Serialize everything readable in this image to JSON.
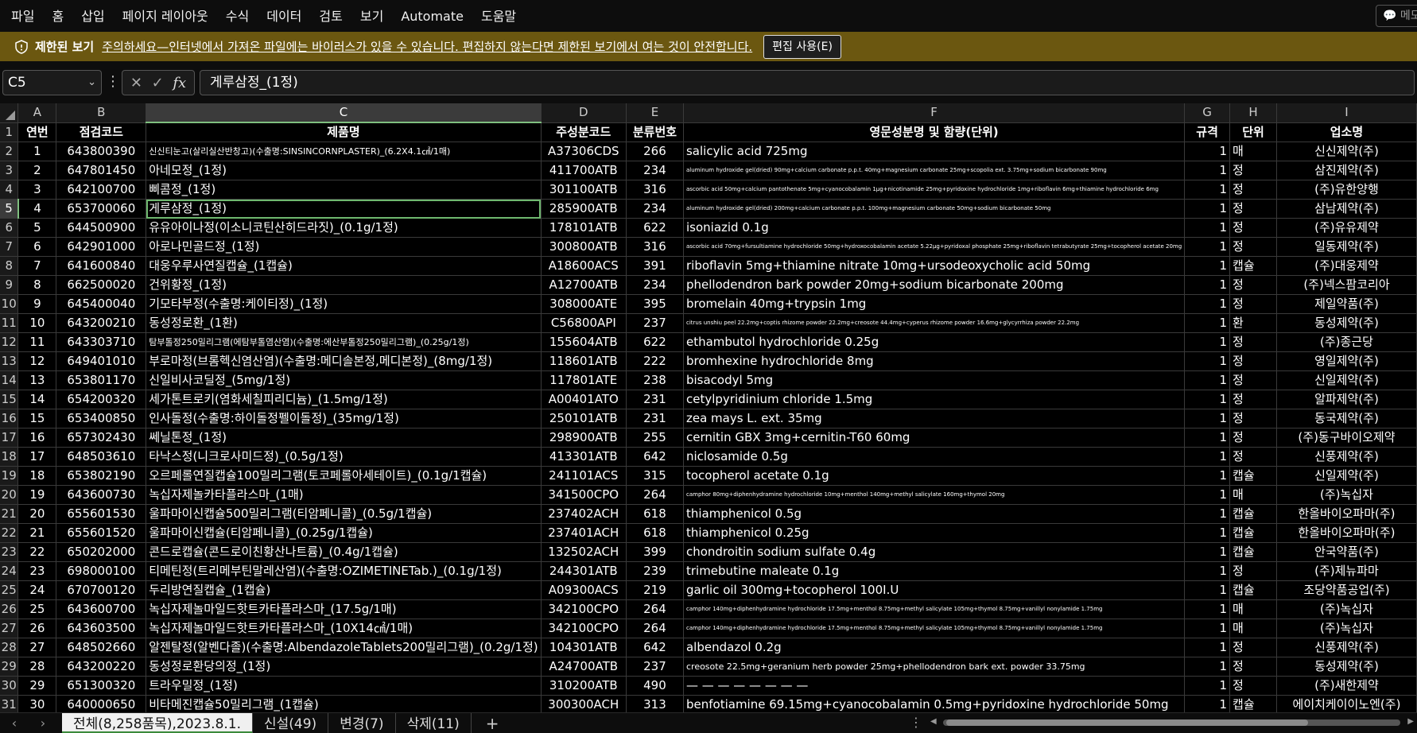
{
  "menu": [
    "파일",
    "홈",
    "삽입",
    "페이지 레이아웃",
    "수식",
    "데이터",
    "검토",
    "보기",
    "Automate",
    "도움말"
  ],
  "comment_label": "메모",
  "protected": {
    "title": "제한된 보기",
    "message": "주의하세요—인터넷에서 가져온 파일에는 바이러스가 있을 수 있습니다. 편집하지 않는다면 제한된 보기에서 여는 것이 안전합니다.",
    "button": "편집 사용(E)"
  },
  "formula": {
    "namebox": "C5",
    "value": "게루삼정_(1정)",
    "cancel_icon": "✕",
    "enter_icon": "✓",
    "fx": "fx"
  },
  "columns": [
    "A",
    "B",
    "C",
    "D",
    "E",
    "F",
    "G",
    "H",
    "I"
  ],
  "header_row": [
    "연번",
    "점검코드",
    "제품명",
    "주성분코드",
    "분류번호",
    "영문성분명 및 함량(단위)",
    "규격",
    "단위",
    "업소명"
  ],
  "rows": [
    [
      "1",
      "643800390",
      "신신티눈고(살리실산반창고)(수출명:SINSINCORNPLASTER)_(6.2X4.1㎠/1매)",
      "A37306CDS",
      "266",
      "salicylic acid   725mg",
      "1",
      "매",
      "신신제약(주)"
    ],
    [
      "2",
      "647801450",
      "아네모정_(1정)",
      "411700ATB",
      "234",
      "aluminum hydroxide gel(dried)   90mg+calcium carbonate p.p.t.   40mg+magnesium carbonate   25mg+scopolia ext.   3.75mg+sodium bicarbonate   90mg",
      "1",
      "정",
      "삼진제약(주)"
    ],
    [
      "3",
      "642100700",
      "삐콤정_(1정)",
      "301100ATB",
      "316",
      "ascorbic acid   50mg+calcium pantothenate   5mg+cyanocobalamin   1μg+nicotinamide   25mg+pyridoxine hydrochloride   1mg+riboflavin   6mg+thiamine hydrochloride   6mg",
      "1",
      "정",
      "(주)유한양행"
    ],
    [
      "4",
      "653700060",
      "게루삼정_(1정)",
      "285900ATB",
      "234",
      "aluminum hydroxide gel(dried)   200mg+calcium carbonate p.p.t.   100mg+magnesium carbonate   50mg+sodium bicarbonate   50mg",
      "1",
      "정",
      "삼남제약(주)"
    ],
    [
      "5",
      "644500900",
      "유유아이나정(이소니코틴산히드라짓)_(0.1g/1정)",
      "178101ATB",
      "622",
      "isoniazid   0.1g",
      "1",
      "정",
      "(주)유유제약"
    ],
    [
      "6",
      "642901000",
      "아로나민골드정_(1정)",
      "300800ATB",
      "316",
      "ascorbic acid   70mg+fursultiamine hydrochloride   50mg+hydroxocobalamin acetate   5.22μg+pyridoxal phosphate   25mg+riboflavin tetrabutyrate   25mg+tocopherol acetate   20mg",
      "1",
      "정",
      "일동제약(주)"
    ],
    [
      "7",
      "641600840",
      "대웅우루사연질캡슐_(1캡슐)",
      "A18600ACS",
      "391",
      "riboflavin   5mg+thiamine nitrate   10mg+ursodeoxycholic acid   50mg",
      "1",
      "캡슐",
      "(주)대웅제약"
    ],
    [
      "8",
      "662500020",
      "건위황정_(1정)",
      "A12700ATB",
      "234",
      "phellodendron bark powder   20mg+sodium bicarbonate   200mg",
      "1",
      "정",
      "(주)넥스팜코리아"
    ],
    [
      "9",
      "645400040",
      "기모타부정(수출명:케이티정)_(1정)",
      "308000ATE",
      "395",
      "bromelain   40mg+trypsin   1mg",
      "1",
      "정",
      "제일약품(주)"
    ],
    [
      "10",
      "643200210",
      "동성정로환_(1환)",
      "C56800API",
      "237",
      "citrus unshiu peel   22.2mg+coptis rhizome powder   22.2mg+creosote   44.4mg+cyperus rhizome powder   16.6mg+glycyrrhiza powder   22.2mg",
      "1",
      "환",
      "동성제약(주)"
    ],
    [
      "11",
      "643303710",
      "탐부톨정250밀리그램(에탐부톨염산염)(수출명:에산부톨정250밀리그램)_(0.25g/1정)",
      "155604ATB",
      "622",
      "ethambutol hydrochloride   0.25g",
      "1",
      "정",
      "(주)종근당"
    ],
    [
      "12",
      "649401010",
      "부로마정(브롬헥신염산염)(수출명:메디솔본정,메디본정)_(8mg/1정)",
      "118601ATB",
      "222",
      "bromhexine hydrochloride   8mg",
      "1",
      "정",
      "영일제약(주)"
    ],
    [
      "13",
      "653801170",
      "신일비사코딜정_(5mg/1정)",
      "117801ATE",
      "238",
      "bisacodyl   5mg",
      "1",
      "정",
      "신일제약(주)"
    ],
    [
      "14",
      "654200320",
      "세가톤트로키(염화세칠피리디늄)_(1.5mg/1정)",
      "A00401ATO",
      "231",
      "cetylpyridinium chloride   1.5mg",
      "1",
      "정",
      "알파제약(주)"
    ],
    [
      "15",
      "653400850",
      "인사돌정(수출명:하이돌정펠이돌정)_(35mg/1정)",
      "250101ATB",
      "231",
      "zea mays L. ext.   35mg",
      "1",
      "정",
      "동국제약(주)"
    ],
    [
      "16",
      "657302430",
      "쎄닐톤정_(1정)",
      "298900ATB",
      "255",
      "cernitin GBX   3mg+cernitin-T60   60mg",
      "1",
      "정",
      "(주)동구바이오제약"
    ],
    [
      "17",
      "648503610",
      "타낙스정(니크로사미드정)_(0.5g/1정)",
      "413301ATB",
      "642",
      "niclosamide   0.5g",
      "1",
      "정",
      "신풍제약(주)"
    ],
    [
      "18",
      "653802190",
      "오르페롤연질캡슐100밀리그램(토코페롤아세테이트)_(0.1g/1캡슐)",
      "241101ACS",
      "315",
      "tocopherol acetate   0.1g",
      "1",
      "캡슐",
      "신일제약(주)"
    ],
    [
      "19",
      "643600730",
      "녹십자제놀카타플라스마_(1매)",
      "341500CPO",
      "264",
      "camphor   80mg+diphenhydramine hydrochloride   10mg+menthol   140mg+methyl salicylate   160mg+thymol   20mg",
      "1",
      "매",
      "(주)녹십자"
    ],
    [
      "20",
      "655601530",
      "울파마이신캡슐500밀리그램(티암페니콜)_(0.5g/1캡슐)",
      "237402ACH",
      "618",
      "thiamphenicol   0.5g",
      "1",
      "캡슐",
      "한올바이오파마(주)"
    ],
    [
      "21",
      "655601520",
      "울파마이신캡슐(티암페니콜)_(0.25g/1캡슐)",
      "237401ACH",
      "618",
      "thiamphenicol   0.25g",
      "1",
      "캡슐",
      "한올바이오파마(주)"
    ],
    [
      "22",
      "650202000",
      "콘드로캡슐(콘드로이친황산나트륨)_(0.4g/1캡슐)",
      "132502ACH",
      "399",
      "chondroitin sodium sulfate   0.4g",
      "1",
      "캡슐",
      "안국약품(주)"
    ],
    [
      "23",
      "698000100",
      "티메틴정(트리메부틴말레산염)(수출명:OZIMETINETab.)_(0.1g/1정)",
      "244301ATB",
      "239",
      "trimebutine maleate   0.1g",
      "1",
      "정",
      "(주)제뉴파마"
    ],
    [
      "24",
      "670700120",
      "두리방연질캡슐_(1캡슐)",
      "A09300ACS",
      "219",
      "garlic oil   300mg+tocopherol   100I.U",
      "1",
      "캡슐",
      "조당약품공업(주)"
    ],
    [
      "25",
      "643600700",
      "녹십자제놀마일드핫트카타플라스마_(17.5g/1매)",
      "342100CPO",
      "264",
      "camphor   140mg+diphenhydramine hydrochloride   17.5mg+menthol   8.75mg+methyl salicylate   105mg+thymol   8.75mg+vanillyl nonylamide   1.75mg",
      "1",
      "매",
      "(주)녹십자"
    ],
    [
      "26",
      "643603500",
      "녹십자제놀마일드핫트카타플라스마_(10X14㎠/1매)",
      "342100CPO",
      "264",
      "camphor   140mg+diphenhydramine hydrochloride   17.5mg+menthol   8.75mg+methyl salicylate   105mg+thymol   8.75mg+vanillyl nonylamide   1.75mg",
      "1",
      "매",
      "(주)녹십자"
    ],
    [
      "27",
      "648502660",
      "알젠탈정(알벤다졸)(수출명:AlbendazoleTablets200밀리그램)_(0.2g/1정)",
      "104301ATB",
      "642",
      "albendazol   0.2g",
      "1",
      "정",
      "신풍제약(주)"
    ],
    [
      "28",
      "643200220",
      "동성정로환당의정_(1정)",
      "A24700ATB",
      "237",
      "creosote 22.5mg+geranium herb powder 25mg+phellodendron bark ext. powder 33.75mg",
      "1",
      "정",
      "동성제약(주)"
    ],
    [
      "29",
      "651300320",
      "트라우밀정_(1정)",
      "310200ATB",
      "490",
      "— — — — — — — —",
      "1",
      "정",
      "(주)새한제약"
    ],
    [
      "30",
      "640000650",
      "비타메진캡슐50밀리그램_(1캡슐)",
      "300300ACH",
      "313",
      "benfotiamine   69.15mg+cyanocobalamin   0.5mg+pyridoxine hydrochloride   50mg",
      "1",
      "캡슐",
      "에이치케이이노엔(주)"
    ]
  ],
  "sheets": {
    "active": "전체(8,258품목),2023.8.1.",
    "others": [
      "신설(49)",
      "변경(7)",
      "삭제(11)"
    ],
    "add": "+"
  }
}
